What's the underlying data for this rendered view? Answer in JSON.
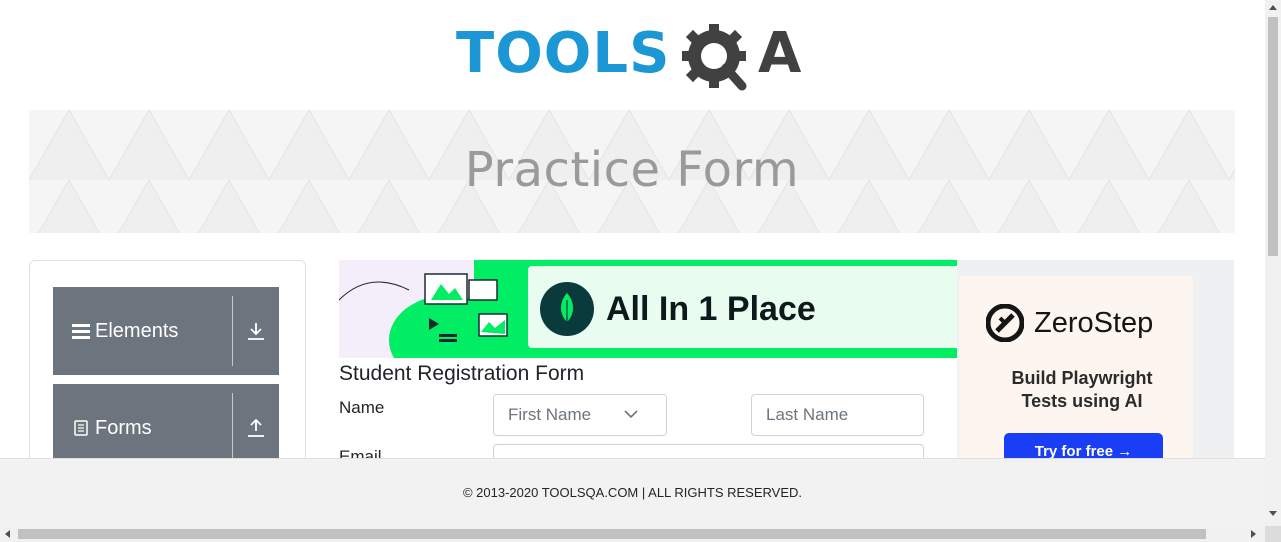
{
  "header": {
    "logo_text_left": "TOOLS",
    "logo_text_right": "A",
    "logo_colors": {
      "tools": "#1a97d4",
      "qa": "#414141"
    }
  },
  "banner": {
    "title": "Practice Form"
  },
  "left_nav": {
    "groups": [
      {
        "label": "Elements",
        "icon": "hamburger-icon",
        "arrow": "download-arrow-icon"
      },
      {
        "label": "Forms",
        "icon": "document-icon",
        "arrow": "upload-arrow-icon"
      }
    ]
  },
  "ad_strip": {
    "headline": "All In 1 Place",
    "brand_color": "#00ed64"
  },
  "form": {
    "title": "Student Registration Form",
    "name_label": "Name",
    "first_name_placeholder": "First Name",
    "last_name_placeholder": "Last Name",
    "email_label": "Email"
  },
  "right_ad": {
    "brand": "ZeroStep",
    "subtitle_line1": "Build Playwright",
    "subtitle_line2": "Tests using AI",
    "cta": "Try for free →",
    "cta_color": "#1a3ef5"
  },
  "footer": {
    "copyright": "© 2013-2020 TOOLSQA.COM | ALL RIGHTS RESERVED."
  }
}
